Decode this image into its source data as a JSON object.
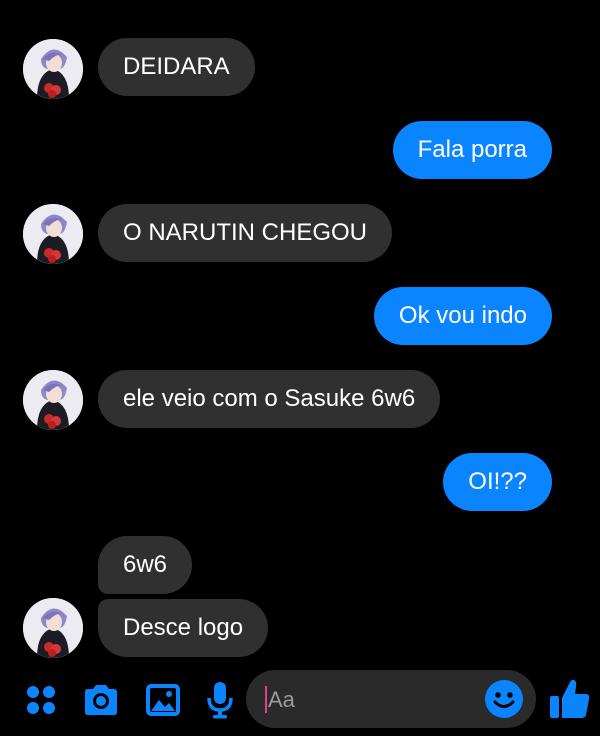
{
  "colors": {
    "background": "#000000",
    "incoming_bubble": "#303030",
    "outgoing_bubble": "#0a84ff",
    "accent": "#0a84ff",
    "text": "#ffffff",
    "placeholder": "#9b9b9b"
  },
  "contact": {
    "avatar_icon": "contact-avatar"
  },
  "messages": [
    {
      "direction": "incoming",
      "text": "DEIDARA"
    },
    {
      "direction": "outgoing",
      "text": "Fala porra"
    },
    {
      "direction": "incoming",
      "text": "O NARUTIN CHEGOU"
    },
    {
      "direction": "outgoing",
      "text": "Ok vou indo"
    },
    {
      "direction": "incoming",
      "text": "ele veio com o Sasuke 6w6"
    },
    {
      "direction": "outgoing",
      "text": "OI!??"
    },
    {
      "direction": "incoming",
      "text": "6w6"
    },
    {
      "direction": "incoming",
      "text": "Desce logo"
    }
  ],
  "composer": {
    "placeholder": "Aa",
    "icons": [
      "menu-dots-icon",
      "camera-icon",
      "image-icon",
      "microphone-icon",
      "emoji-icon",
      "like-icon"
    ]
  }
}
